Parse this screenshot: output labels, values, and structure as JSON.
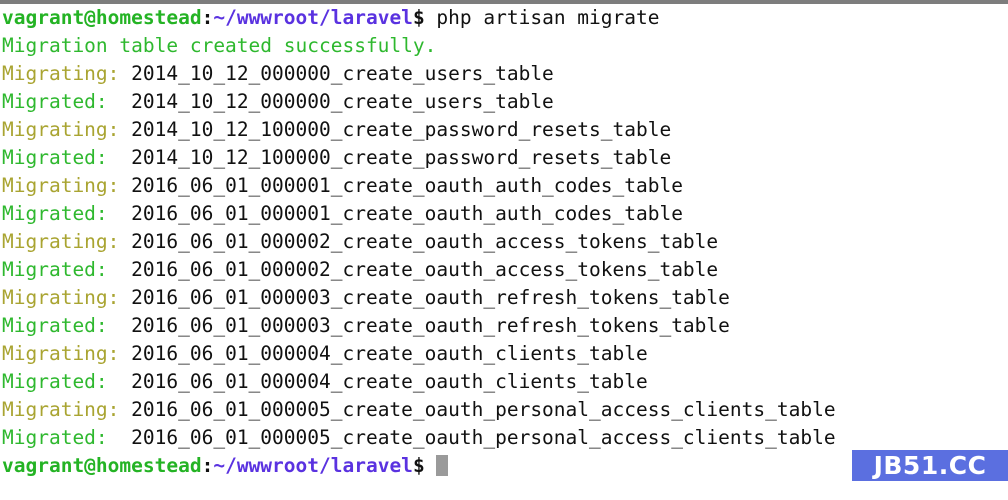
{
  "terminal": {
    "prompt": {
      "user_host": "vagrant@homestead",
      "separator": ":",
      "path": "~/wwwroot/laravel",
      "sigil": "$"
    },
    "command": " php artisan migrate",
    "status_line": "Migration table created successfully.",
    "labels": {
      "migrating": "Migrating:",
      "migrated": "Migrated: "
    },
    "migrations": [
      "2014_10_12_000000_create_users_table",
      "2014_10_12_100000_create_password_resets_table",
      "2016_06_01_000001_create_oauth_auth_codes_table",
      "2016_06_01_000002_create_oauth_access_tokens_table",
      "2016_06_01_000003_create_oauth_refresh_tokens_table",
      "2016_06_01_000004_create_oauth_clients_table",
      "2016_06_01_000005_create_oauth_personal_access_clients_table"
    ],
    "trailing_space": " ",
    "colors": {
      "prompt_user": "#24b324",
      "prompt_path": "#5a32e0",
      "success": "#2eb82e",
      "migrating": "#a9a431",
      "text": "#111111",
      "cursor": "#9a9a9a",
      "topbar": "#7d7d7d"
    }
  },
  "watermark": {
    "label": "JB51.CC",
    "background": "#5b6fe0",
    "color": "#ffffff"
  }
}
